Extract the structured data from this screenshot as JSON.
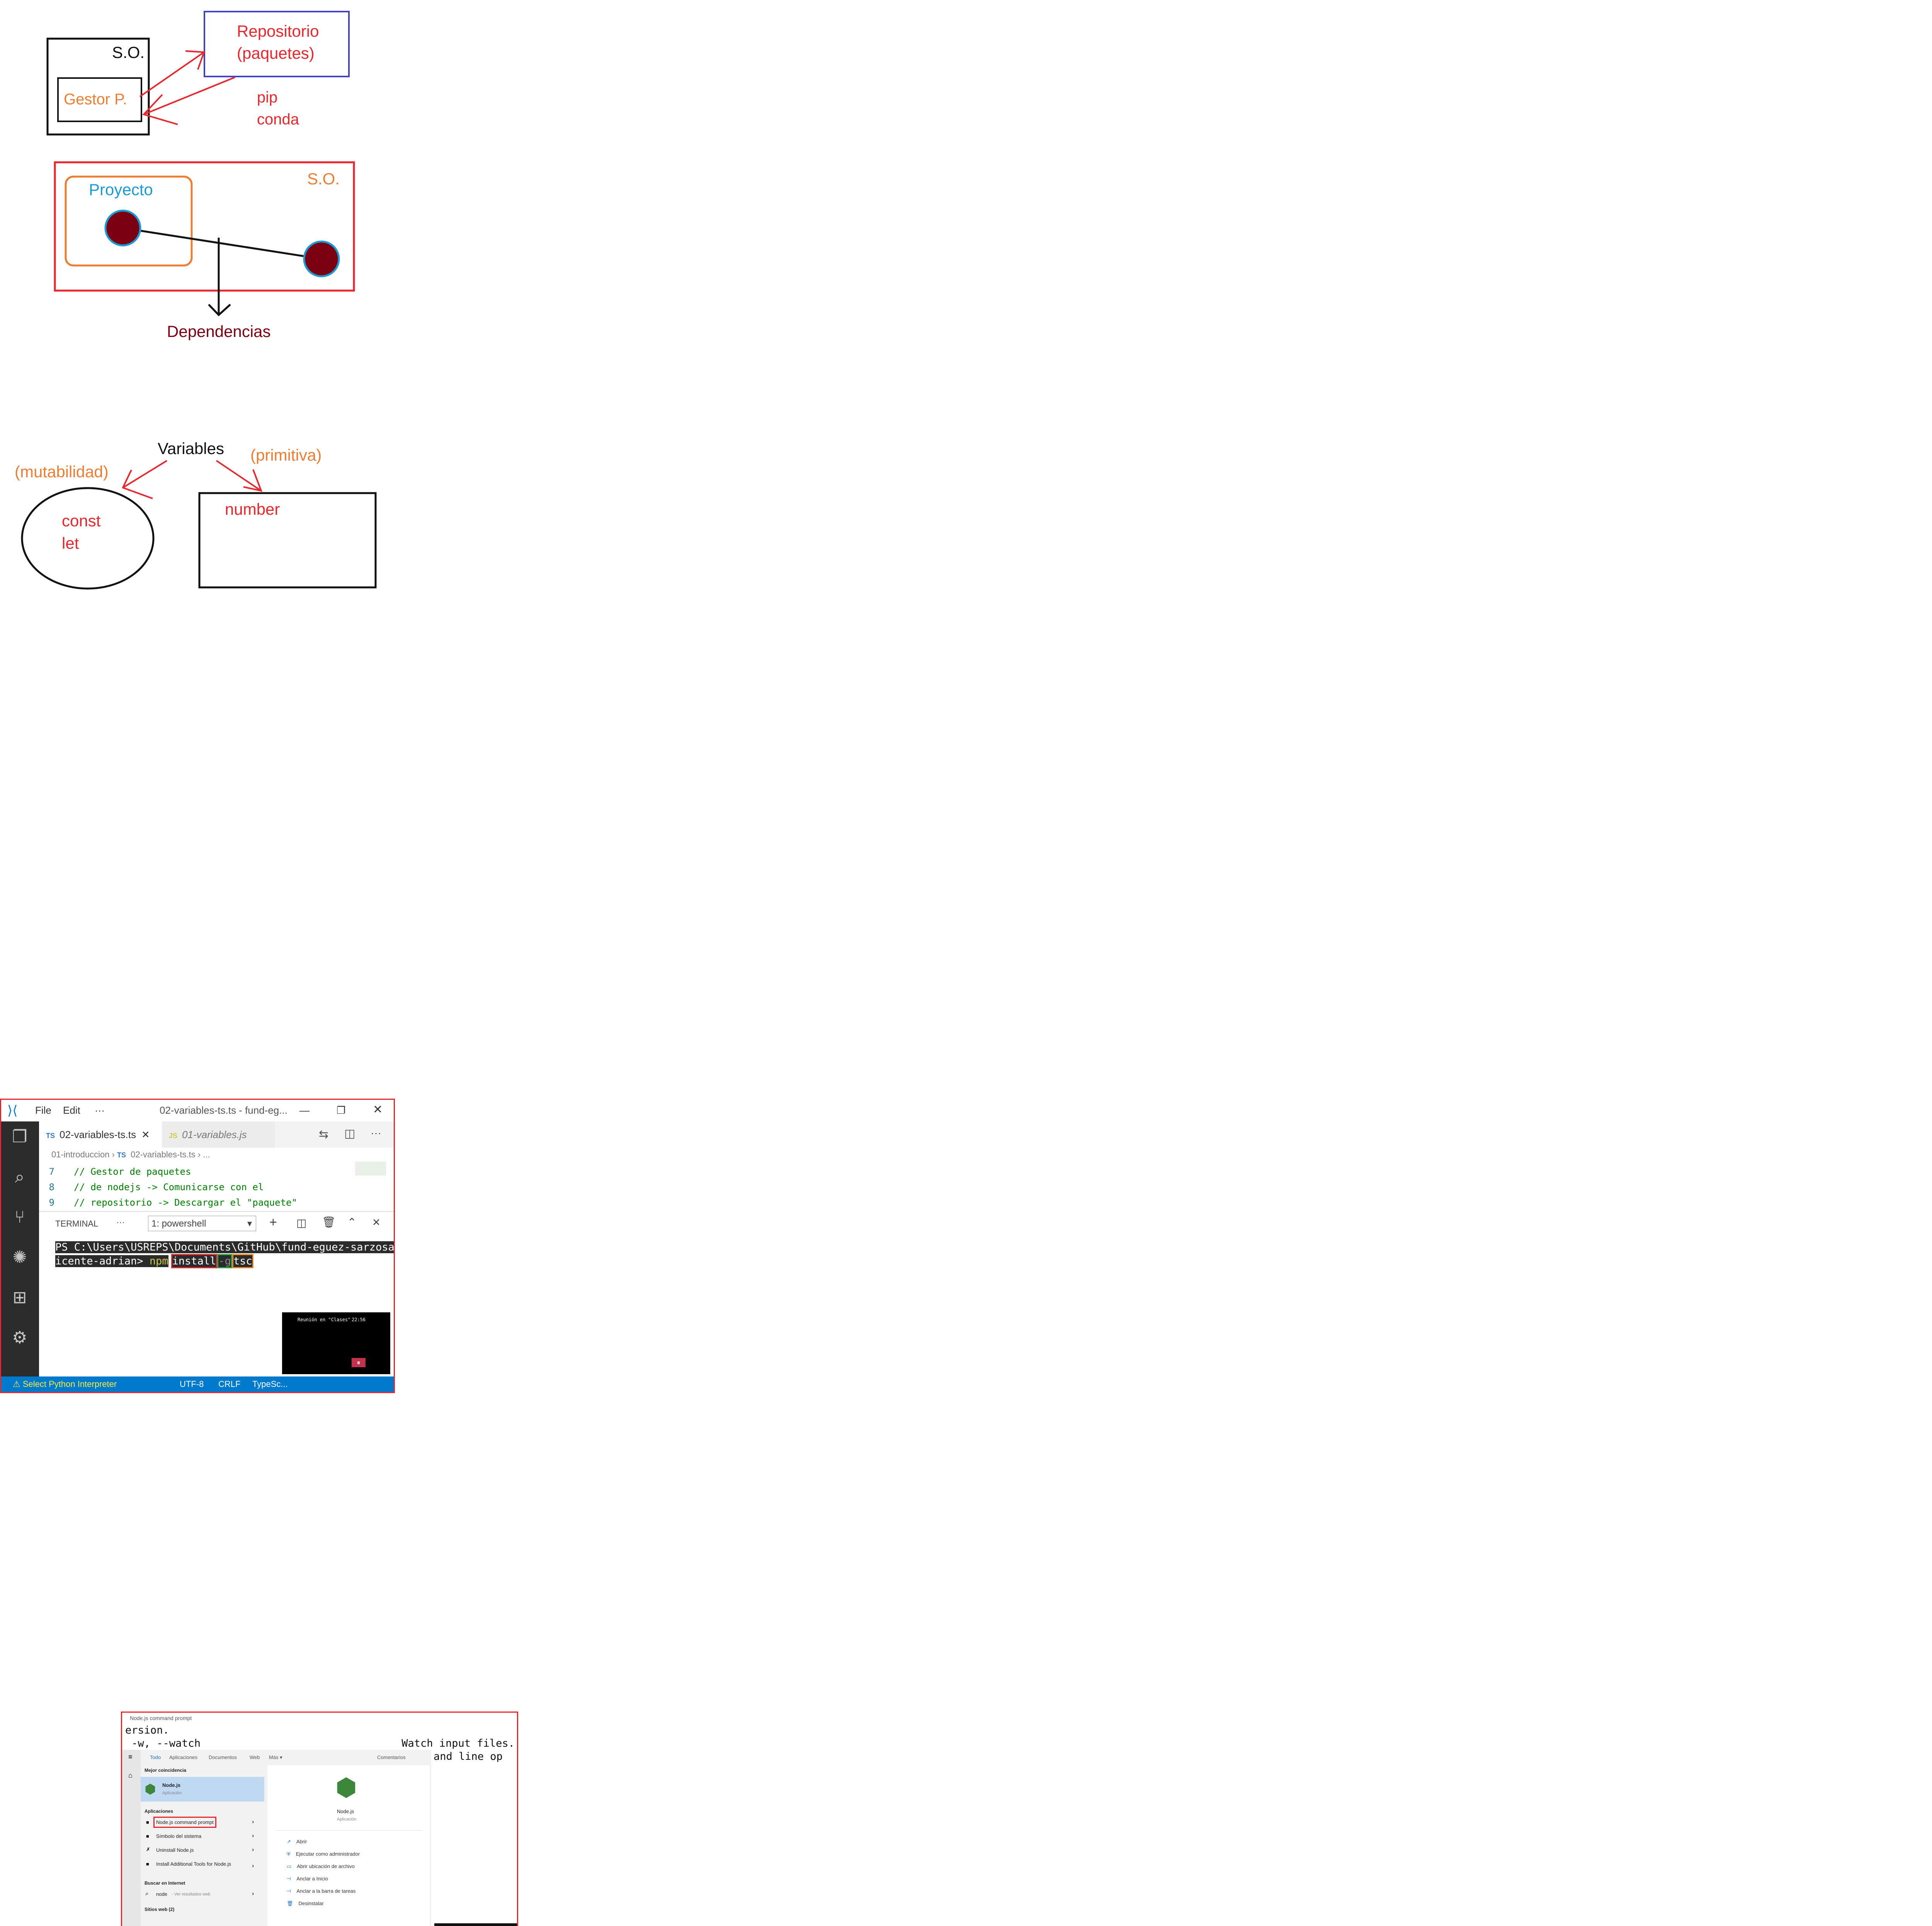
{
  "diagram1": {
    "so_label": "S.O.",
    "gestor_label": "Gestor P.",
    "repo_line1": "Repositorio",
    "repo_line2": "(paquetes)",
    "tool_line1": "pip",
    "tool_line2": "conda"
  },
  "diagram2": {
    "so_label": "S.O.",
    "proyecto_label": "Proyecto",
    "dependencias_label": "Dependencias"
  },
  "diagram3": {
    "variables_label": "Variables",
    "mutabilidad_label": "(mutabilidad)",
    "primitiva_label": "(primitiva)",
    "const_label": "const",
    "let_label": "let",
    "number_label": "number"
  },
  "vscode": {
    "menu_file": "File",
    "menu_edit": "Edit",
    "menu_more": "···",
    "window_title": "02-variables-ts.ts - fund-eg...",
    "tab_active": "02-variables-ts.ts",
    "tab_inactive": "01-variables.js",
    "tab_active_badge": "TS",
    "tab_inactive_badge": "JS",
    "breadcrumb_folder": "01-introduccion",
    "breadcrumb_file": "02-variables-ts.ts",
    "breadcrumb_more": "...",
    "code_lines": [
      {
        "num": "7",
        "text": "// Gestor de paquetes"
      },
      {
        "num": "8",
        "text": "// de nodejs -> Comunicarse con el"
      },
      {
        "num": "9",
        "text": "// repositorio -> Descargar el \"paquete\""
      }
    ],
    "panel_tab": "TERMINAL",
    "panel_more": "···",
    "terminal_select": "1: powershell",
    "terminal_line1": "PS C:\\Users\\USREPS\\Documents\\GitHub\\fund-eguez-sarzosa-v",
    "terminal_line2_prefix": "icente-adrian> ",
    "terminal_npm": "npm",
    "terminal_install": "install",
    "terminal_flag": "-g",
    "terminal_pkg": "tsc",
    "meeting_title": "Reunión en \"Clases\"",
    "meeting_time": "22:56",
    "status_python": "Select Python Interpreter",
    "status_encoding": "UTF-8",
    "status_eol": "CRLF",
    "status_lang": "TypeSc..."
  },
  "nodeshot": {
    "cmd_title": "Node.js command prompt",
    "cmd_line1": "ersion.",
    "cmd_line2": " -w, --watch                                Watch input files.",
    "cmd_line3_tail": "and line op",
    "tabs": [
      "Todo",
      "Aplicaciones",
      "Documentos",
      "Web",
      "Más ▾"
    ],
    "feedback": "Comentarios",
    "best_match_heading": "Mejor coincidencia",
    "best_match_name": "Node.js",
    "best_match_type": "Aplicación",
    "apps_heading": "Aplicaciones",
    "apps": [
      "Node.js command prompt",
      "Símbolo del sistema",
      "Uninstall Node.js",
      "Install Additional Tools for Node.js"
    ],
    "web_heading": "Buscar en Internet",
    "web_query": "node",
    "web_hint": "- Ver resultados web",
    "sites_heading": "Sitios web (2)",
    "right_name": "Node.js",
    "right_type": "Aplicación",
    "actions": [
      "Abrir",
      "Ejecutar como administrador",
      "Abrir ubicación de archivo",
      "Anclar a Inicio",
      "Anclar a la barra de tareas",
      "Desinstalar"
    ]
  },
  "colors": {
    "red": "#e8262d",
    "orange": "#ed7d31",
    "blue_box": "#4040c8",
    "cyan": "#1a9bd7",
    "dark_red": "#7a0012",
    "black": "#111111"
  }
}
